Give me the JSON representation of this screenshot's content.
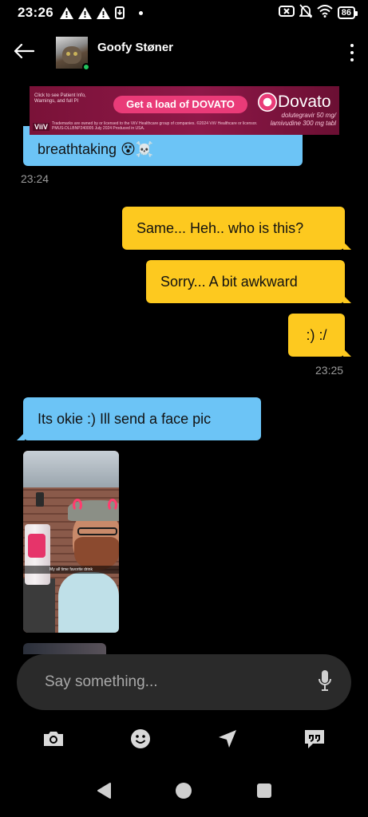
{
  "status_bar": {
    "time": "23:26",
    "battery": "86"
  },
  "header": {
    "contact_name": "Goofy Støner"
  },
  "ad": {
    "small_text": "Click to see Patient Info, Warnings, and full PI",
    "cta": "Get a load of DOVATO",
    "brand": "Dovato",
    "drug": "dolutegravir 50 mg/ lamivudine 300 mg tabl",
    "logo_text": "ViiV",
    "footer": "Trademarks are owned by or licensed to the ViiV Healthcare group of companies. ©2024 ViiV Healthcare or licensor. PMUS-DLLBNP240005 July 2024 Produced in USA."
  },
  "messages": {
    "m1": "breathtaking 😵☠️",
    "t1": "23:24",
    "m2": "Same... Heh.. who is this?",
    "m3": "Sorry... A bit awkward",
    "m4": ":) :/",
    "t2": "23:25",
    "m5": "Its okie :) Ill send a face pic",
    "photo_caption": "My all time favorite drink"
  },
  "composer": {
    "placeholder": "Say something..."
  },
  "colors": {
    "incoming": "#6cc4f6",
    "outgoing": "#fdc91f",
    "online": "#22c55e",
    "ad_accent": "#e93b78"
  },
  "icons": {
    "back": "arrow-left-icon",
    "more": "more-vertical-icon",
    "mic": "microphone-icon",
    "camera": "camera-icon",
    "emoji": "smiley-icon",
    "location": "location-arrow-icon",
    "quick_reply": "quote-chat-icon"
  }
}
